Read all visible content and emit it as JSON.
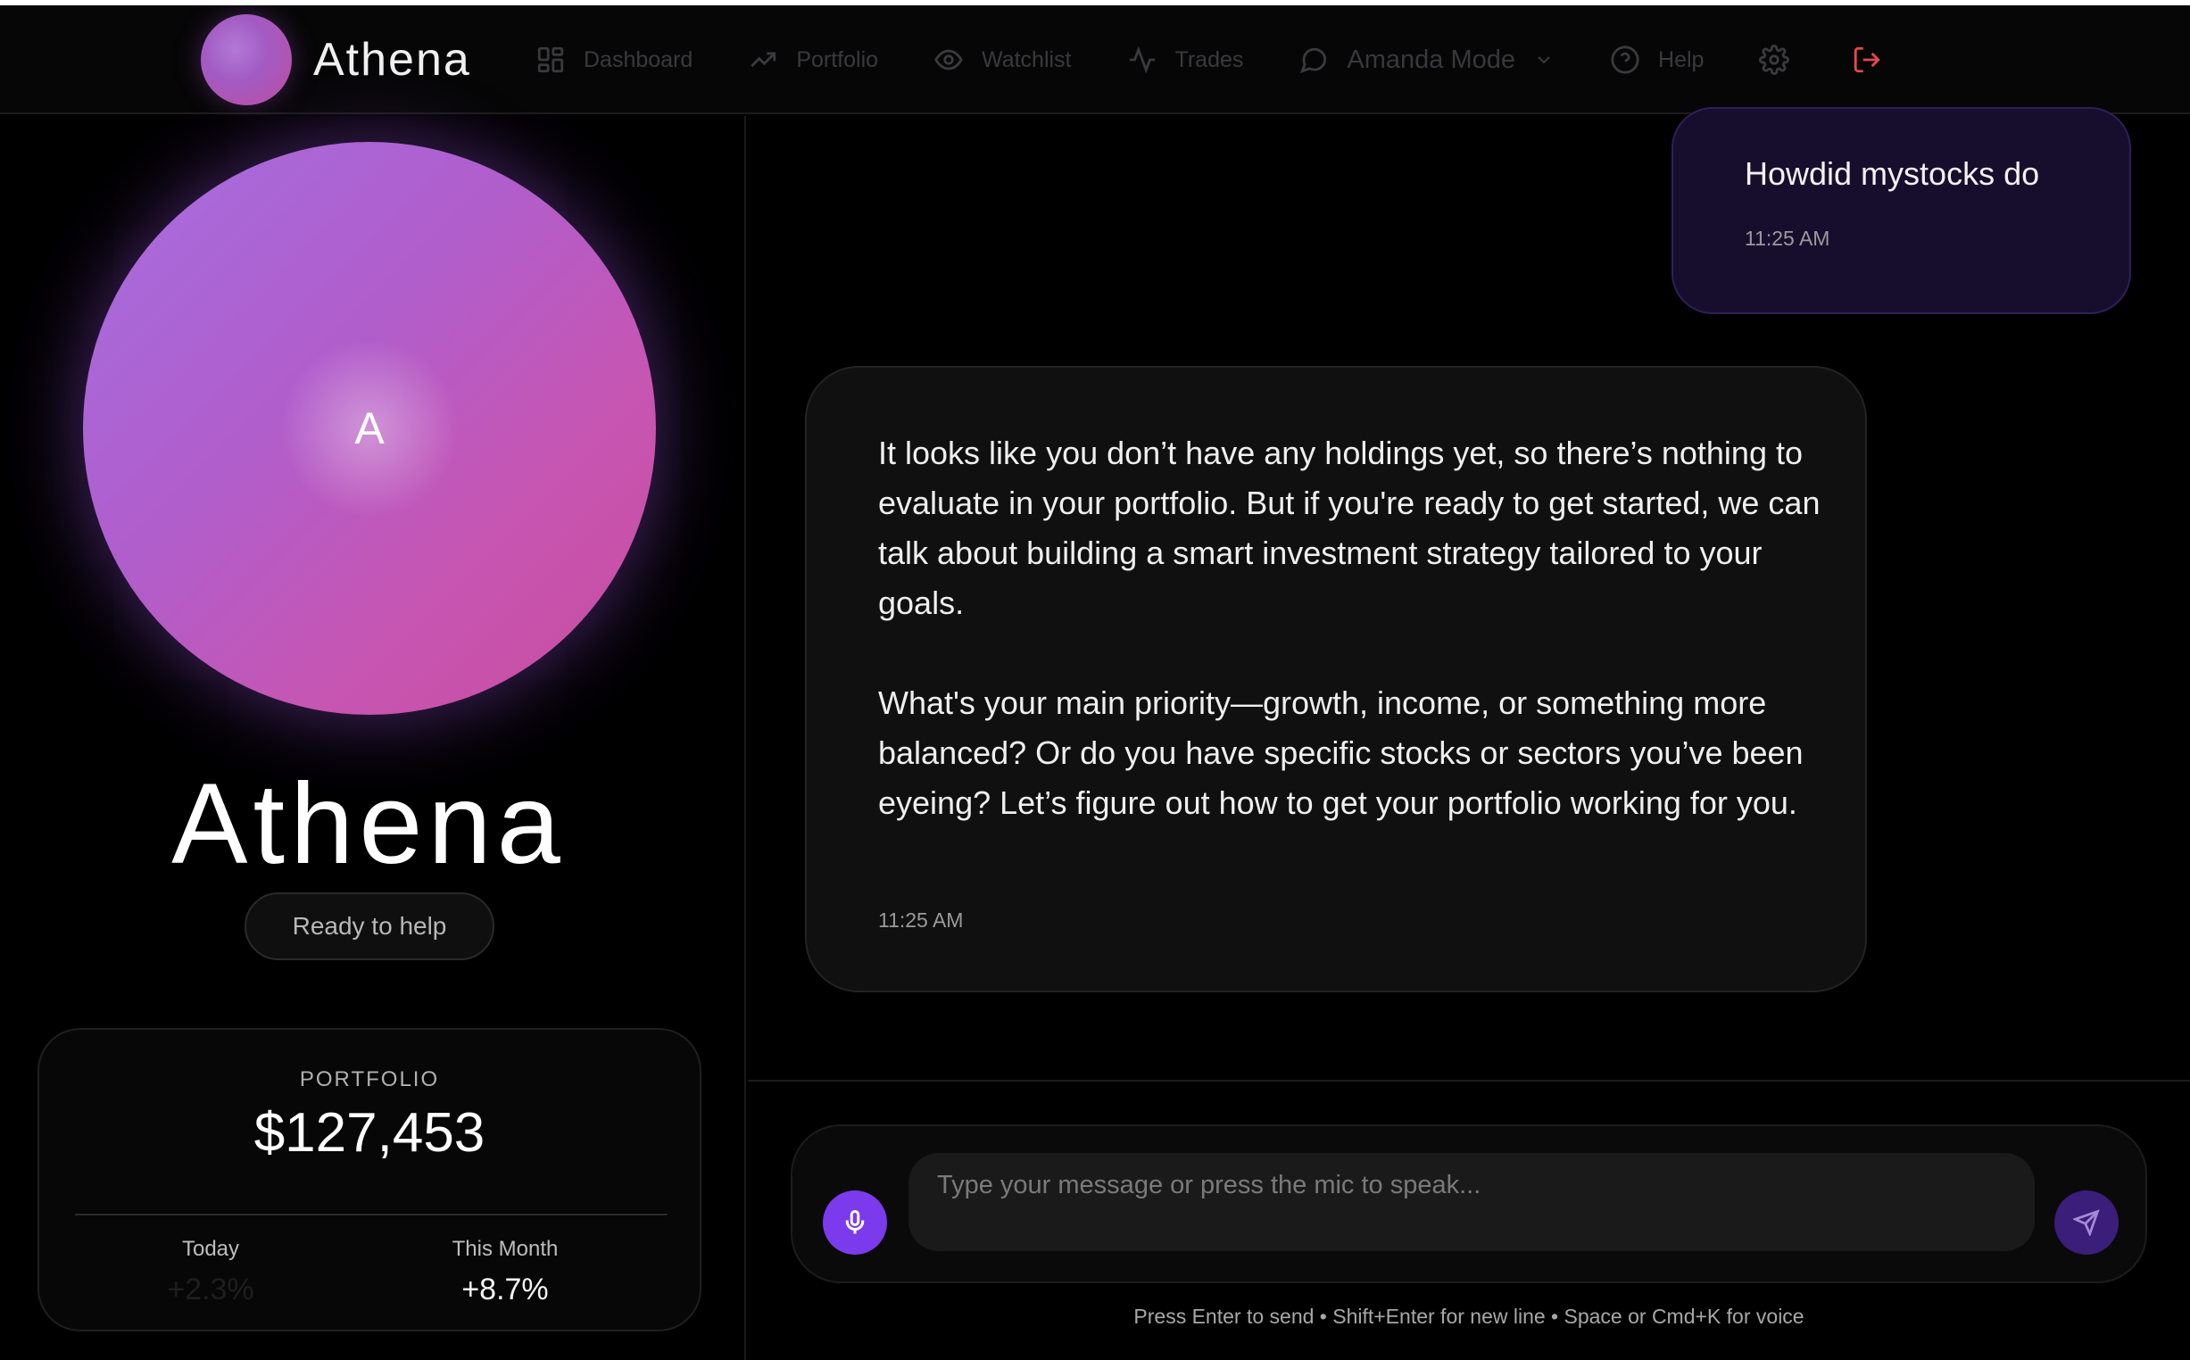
{
  "app": {
    "name": "Athena"
  },
  "nav": {
    "items": [
      {
        "label": "Dashboard",
        "icon": "dashboard-grid-icon"
      },
      {
        "label": "Portfolio",
        "icon": "trending-up-icon"
      },
      {
        "label": "Watchlist",
        "icon": "eye-icon"
      },
      {
        "label": "Trades",
        "icon": "activity-icon"
      }
    ],
    "mode": {
      "label": "Amanda Mode",
      "icon": "chat-bubble-icon"
    },
    "help": {
      "label": "Help",
      "icon": "help-circle-icon"
    },
    "settings_icon": "gear-icon",
    "logout_icon": "logout-icon",
    "logout_color": "#e5484d"
  },
  "assistant": {
    "orb_letter": "A",
    "name": "Athena",
    "status": "Ready to help"
  },
  "portfolio": {
    "label": "PORTFOLIO",
    "value": "$127,453",
    "today_label": "Today",
    "today_value": "+2.3%",
    "month_label": "This Month",
    "month_value": "+8.7%"
  },
  "chat": {
    "messages": [
      {
        "role": "user",
        "text": "Howdid mystocks do",
        "time": "11:25 AM"
      },
      {
        "role": "assistant",
        "paragraphs": [
          "It looks like you don’t have any holdings yet, so there’s nothing to evaluate in your portfolio. But if you're ready to get started, we can talk about building a smart investment strategy tailored to your goals.",
          "What's your main priority—growth, income, or something more balanced? Or do you have specific stocks or sectors you’ve been eyeing? Let’s figure out how to get your portfolio working for you."
        ],
        "time": "11:25 AM"
      }
    ]
  },
  "composer": {
    "placeholder": "Type your message or press the mic to speak...",
    "value": "",
    "mic_icon": "microphone-icon",
    "send_icon": "send-icon",
    "hint": "Press Enter to send • Shift+Enter for new line • Space or Cmd+K for voice"
  },
  "colors": {
    "accent": "#7c3aed",
    "user_bubble": "#170e2e",
    "bot_bubble": "#101010",
    "background": "#000000"
  }
}
